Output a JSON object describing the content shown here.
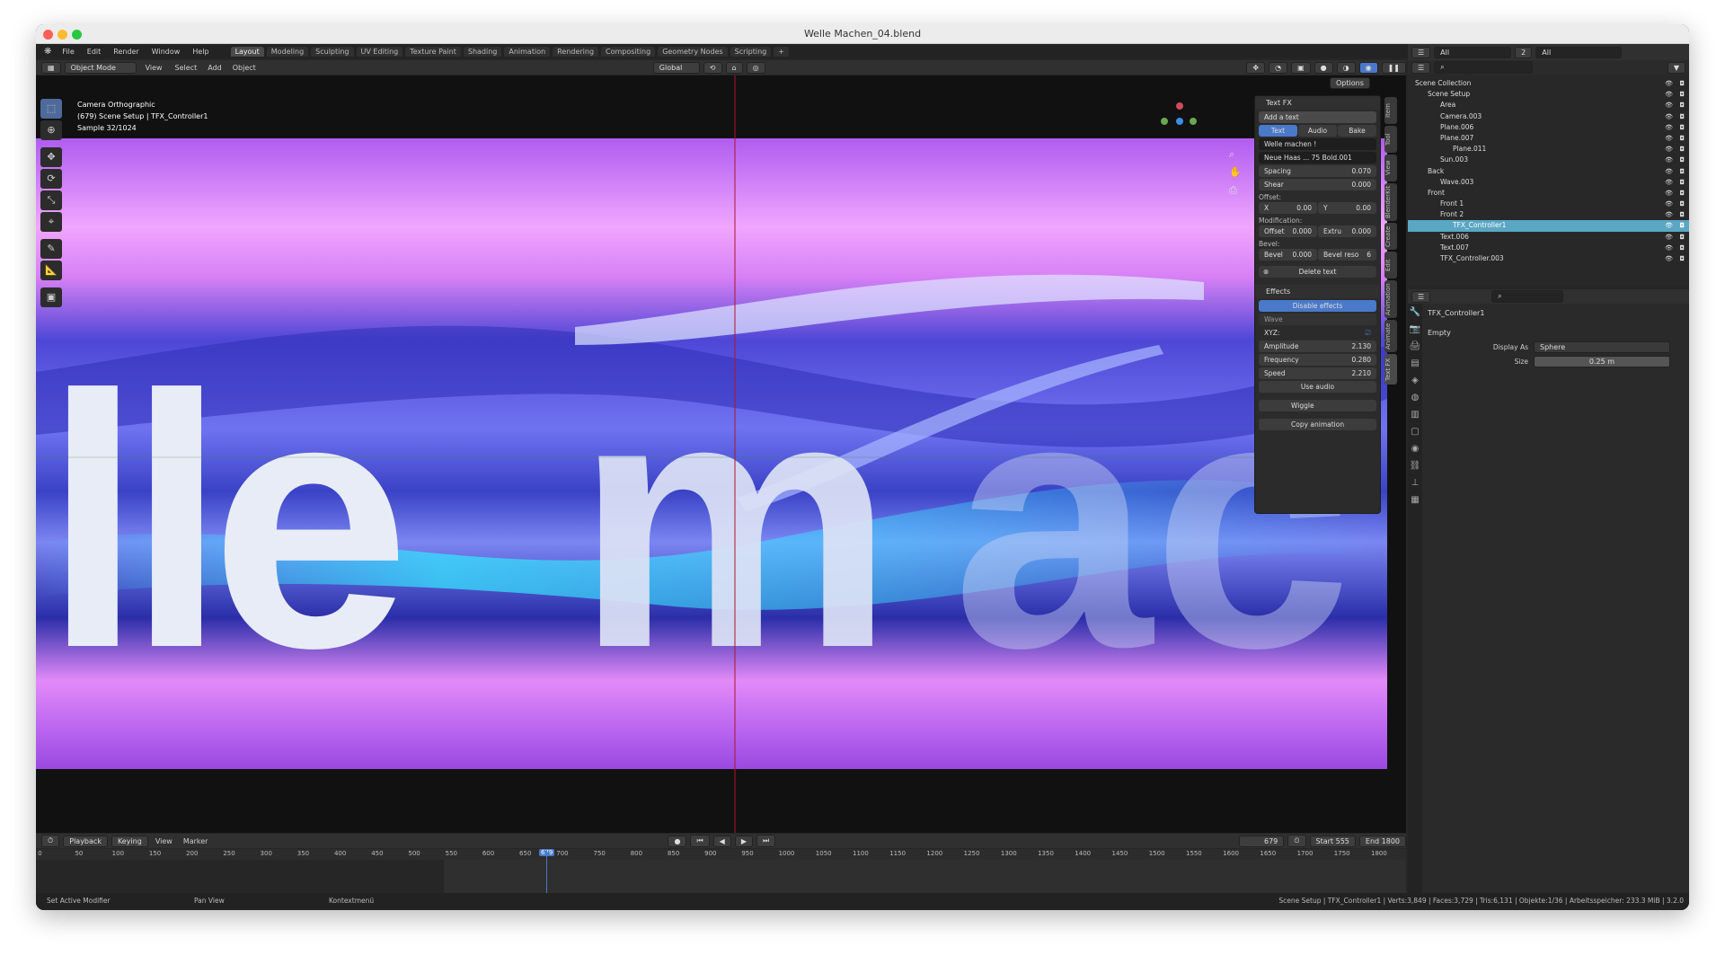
{
  "window": {
    "title": "Welle Machen_04.blend"
  },
  "menu": [
    "File",
    "Edit",
    "Render",
    "Window",
    "Help"
  ],
  "workspaces": [
    "Layout",
    "Modeling",
    "Sculpting",
    "UV Editing",
    "Texture Paint",
    "Shading",
    "Animation",
    "Rendering",
    "Compositing",
    "Geometry Nodes",
    "Scripting"
  ],
  "header": {
    "mode": "Object Mode",
    "view": "View",
    "select": "Select",
    "add": "Add",
    "object": "Object",
    "orientation": "Global",
    "options": "Options"
  },
  "viewport": {
    "line1": "Camera Orthographic",
    "line2": "(679) Scene Setup | TFX_Controller1",
    "line3": "Sample 32/1024",
    "canvas_text": "lle mac"
  },
  "npanel": {
    "title": "Text FX",
    "add_text": "Add a text",
    "tabs": [
      "Text",
      "Audio",
      "Bake"
    ],
    "text_value": "Welle machen !",
    "font": "Neue Haas ... 75 Bold.001",
    "spacing": {
      "label": "Spacing",
      "value": "0.070"
    },
    "shear": {
      "label": "Shear",
      "value": "0.000"
    },
    "offset_label": "Offset:",
    "offset_x": {
      "label": "X",
      "value": "0.00"
    },
    "offset_y": {
      "label": "Y",
      "value": "0.00"
    },
    "modification_label": "Modification:",
    "mod_offset": {
      "label": "Offset",
      "value": "0.000"
    },
    "mod_extru": {
      "label": "Extru",
      "value": "0.000"
    },
    "bevel_label": "Bevel:",
    "bevel": {
      "label": "Bevel",
      "value": "0.000"
    },
    "bevel_reso": {
      "label": "Bevel reso",
      "value": "6"
    },
    "delete_text": "Delete text",
    "effects_title": "Effects",
    "disable_effects": "Disable effects",
    "wave": "Wave",
    "xyz": "XYZ:",
    "amplitude": {
      "label": "Amplitude",
      "value": "2.130"
    },
    "frequency": {
      "label": "Frequency",
      "value": "0.280"
    },
    "speed": {
      "label": "Speed",
      "value": "2.210"
    },
    "use_audio": "Use audio",
    "wiggle": "Wiggle",
    "copy_animation": "Copy animation"
  },
  "sidetabs": [
    "Item",
    "Tool",
    "View",
    "BlenderKit",
    "Create",
    "Edit",
    "Animation",
    "Animate",
    "Text FX"
  ],
  "outliner": {
    "search_filter": "All",
    "count": "2",
    "filter2": "All",
    "rows": [
      {
        "label": "Scene Collection",
        "indent": 0
      },
      {
        "label": "Scene Setup",
        "indent": 1
      },
      {
        "label": "Area",
        "indent": 2
      },
      {
        "label": "Camera.003",
        "indent": 2
      },
      {
        "label": "Plane.006",
        "indent": 2
      },
      {
        "label": "Plane.007",
        "indent": 2
      },
      {
        "label": "Plane.011",
        "indent": 3
      },
      {
        "label": "Sun.003",
        "indent": 2
      },
      {
        "label": "Back",
        "indent": 1
      },
      {
        "label": "Wave.003",
        "indent": 2
      },
      {
        "label": "Front",
        "indent": 1
      },
      {
        "label": "Front 1",
        "indent": 2
      },
      {
        "label": "Front 2",
        "indent": 2
      },
      {
        "label": "TFX_Controller1",
        "indent": 3
      },
      {
        "label": "Text.006",
        "indent": 2
      },
      {
        "label": "Text.007",
        "indent": 2
      },
      {
        "label": "TFX_Controller.003",
        "indent": 2
      }
    ]
  },
  "properties": {
    "object": "TFX_Controller1",
    "section": "Empty",
    "display_as_label": "Display As",
    "display_as": "Sphere",
    "size_label": "Size",
    "size": "0.25 m"
  },
  "timeline": {
    "playback": "Playback",
    "keying": "Keying",
    "view": "View",
    "marker": "Marker",
    "current": "679",
    "start_label": "Start",
    "start": "555",
    "end_label": "End",
    "end": "1800",
    "ticks": [
      "0",
      "50",
      "100",
      "150",
      "200",
      "250",
      "300",
      "350",
      "400",
      "450",
      "500",
      "550",
      "600",
      "650",
      "700",
      "750",
      "800",
      "850",
      "900",
      "950",
      "1000",
      "1050",
      "1100",
      "1150",
      "1200",
      "1250",
      "1300",
      "1350",
      "1400",
      "1450",
      "1500",
      "1550",
      "1600",
      "1650",
      "1700",
      "1750",
      "1800"
    ]
  },
  "status": {
    "left1": "Set Active Modifier",
    "left2": "Pan View",
    "left3": "Kontextmenü",
    "right": "Scene Setup | TFX_Controller1 | Verts:3,849 | Faces:3,729 | Tris:6,131 | Objekte:1/36 | Arbeitsspeicher: 233.3 MiB | 3.2.0"
  },
  "colors": {
    "accent": "#4a79c9",
    "active_tab": "#4d6a9a",
    "highlight_row": "#5aa7c4"
  }
}
